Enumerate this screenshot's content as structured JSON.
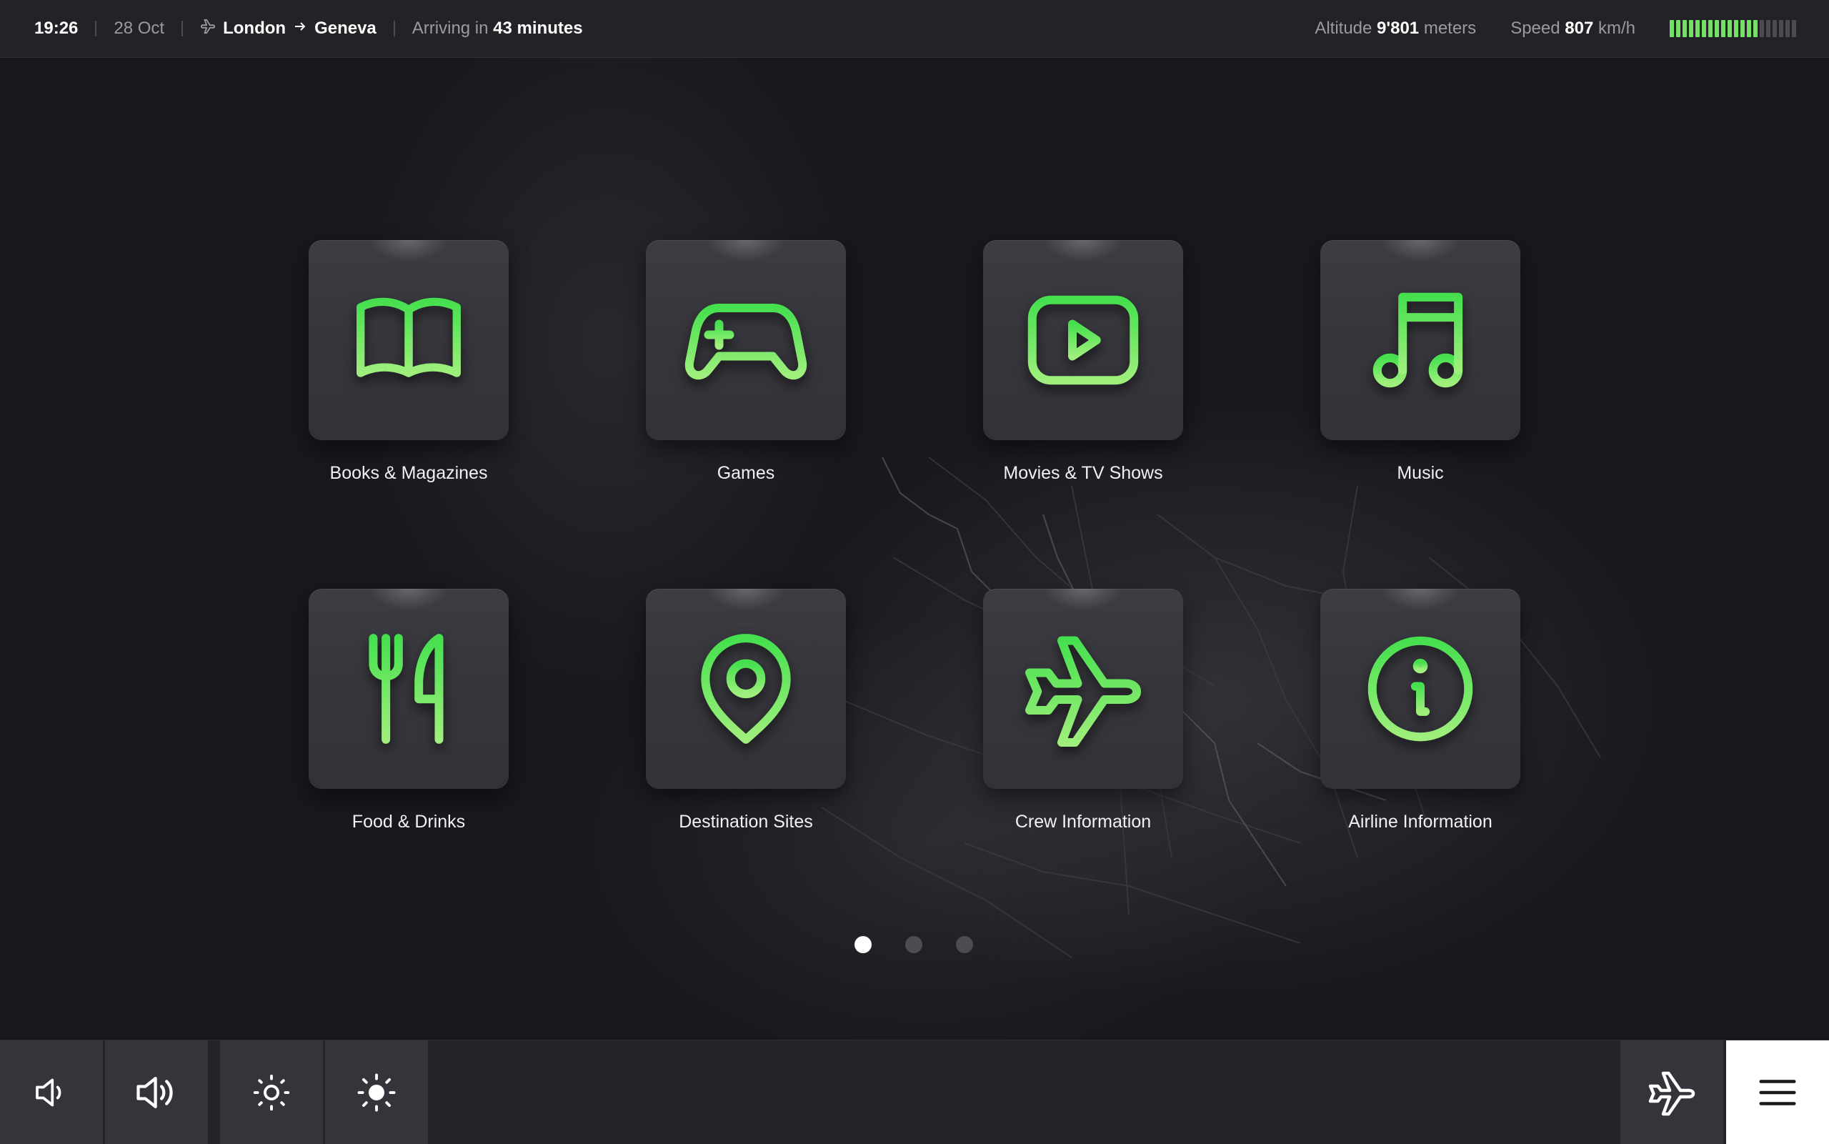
{
  "status_bar": {
    "time": "19:26",
    "date": "28 Oct",
    "origin": "London",
    "destination": "Geneva",
    "arrival_prefix": "Arriving in",
    "arrival_value": "43 minutes",
    "altitude_label": "Altitude",
    "altitude_value": "9'801",
    "altitude_unit": "meters",
    "speed_label": "Speed",
    "speed_value": "807",
    "speed_unit": "km/h",
    "signal_level": 0.69
  },
  "apps": [
    {
      "label": "Books & Magazines",
      "icon": "book-icon"
    },
    {
      "label": "Games",
      "icon": "gamepad-icon"
    },
    {
      "label": "Movies & TV Shows",
      "icon": "play-icon"
    },
    {
      "label": "Music",
      "icon": "music-note-icon"
    },
    {
      "label": "Food & Drinks",
      "icon": "fork-knife-icon"
    },
    {
      "label": "Destination Sites",
      "icon": "map-pin-icon"
    },
    {
      "label": "Crew Information",
      "icon": "airplane-icon"
    },
    {
      "label": "Airline Information",
      "icon": "info-icon"
    }
  ],
  "pager": {
    "pages": 3,
    "current": 1
  },
  "bottom_bar": {
    "buttons": [
      "volume-down-icon",
      "volume-up-icon",
      "brightness-down-icon",
      "brightness-up-icon",
      "airplane-icon",
      "menu-icon"
    ]
  },
  "colors": {
    "accent": "#76e066",
    "accent_dark": "#3fd84a",
    "background": "#17171c",
    "bar": "#222227",
    "tile": "#3a3a40"
  }
}
